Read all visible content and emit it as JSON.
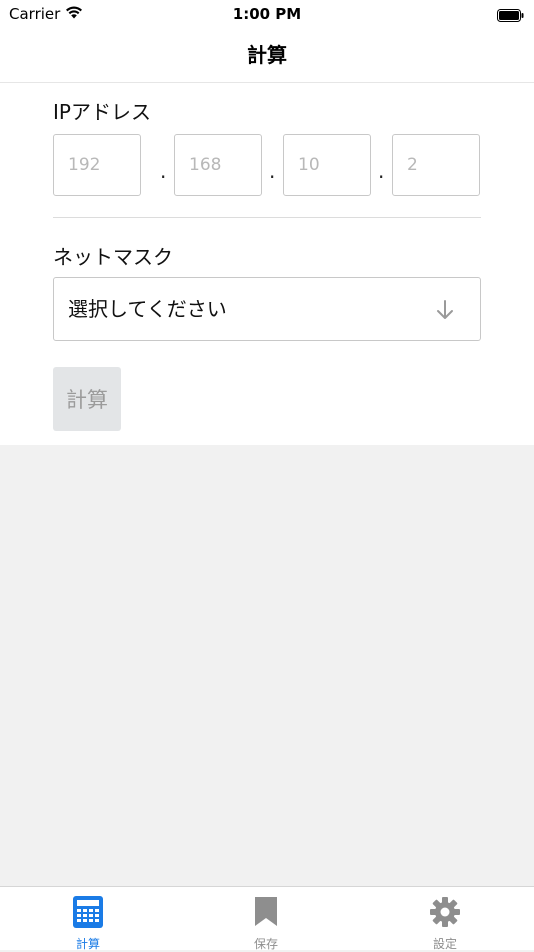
{
  "status_bar": {
    "carrier": "Carrier",
    "time": "1:00 PM"
  },
  "nav": {
    "title": "計算"
  },
  "form": {
    "ip_label": "IPアドレス",
    "ip_fields": [
      {
        "placeholder": "192"
      },
      {
        "placeholder": "168"
      },
      {
        "placeholder": "10"
      },
      {
        "placeholder": "2"
      }
    ],
    "separator": ".",
    "netmask_label": "ネットマスク",
    "netmask_select": "選択してください",
    "calculate_button": "計算"
  },
  "tab_bar": {
    "items": [
      {
        "label": "計算",
        "icon": "calculator-icon",
        "active": true
      },
      {
        "label": "保存",
        "icon": "bookmark-icon",
        "active": false
      },
      {
        "label": "設定",
        "icon": "gear-icon",
        "active": false
      }
    ]
  },
  "colors": {
    "accent": "#1a7be6",
    "inactive": "#8e8e8e",
    "background": "#f1f1f1"
  }
}
